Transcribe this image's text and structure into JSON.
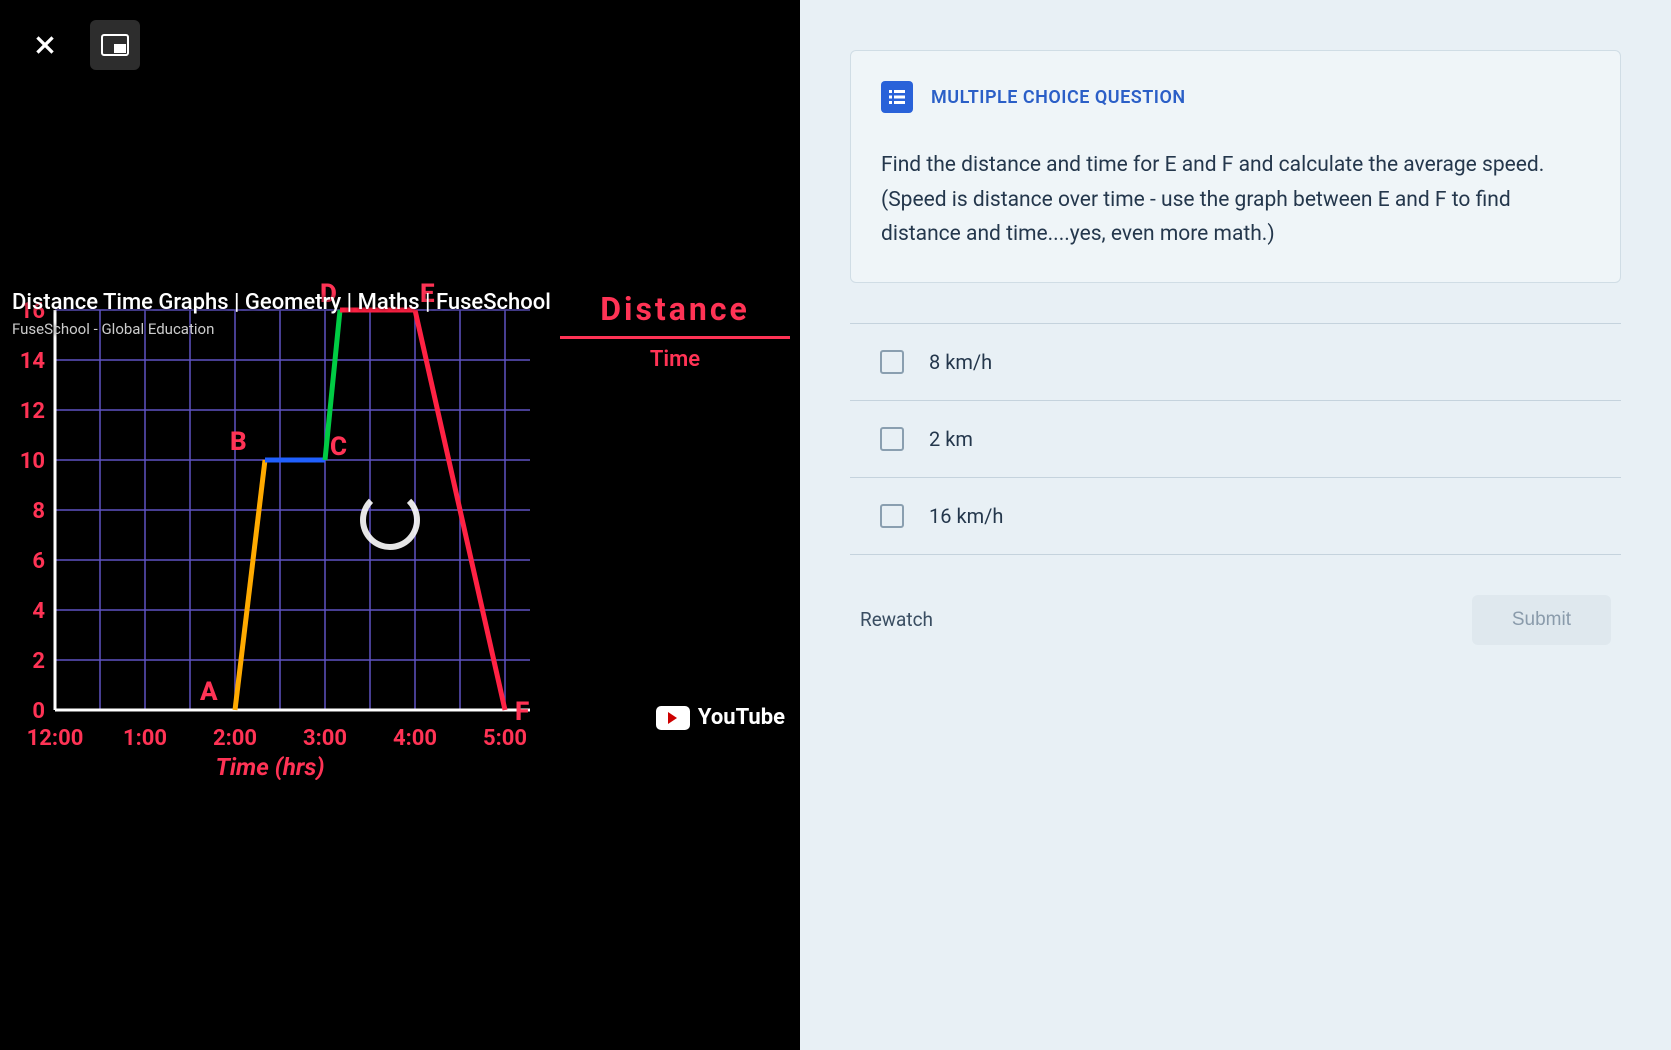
{
  "video": {
    "title": "Distance Time Graphs | Geometry | Maths | FuseSchool",
    "channel": "FuseSchool - Global Education",
    "brand": "YouTube"
  },
  "formula": {
    "numerator": "Distance",
    "denominator": "Time"
  },
  "chart_data": {
    "type": "line",
    "xlabel": "Time (hrs)",
    "ylabel": "",
    "x_ticks": [
      "12:00",
      "1:00",
      "2:00",
      "3:00",
      "4:00",
      "5:00"
    ],
    "y_ticks": [
      0,
      2,
      4,
      6,
      8,
      10,
      12,
      14,
      16
    ],
    "ylim": [
      0,
      16
    ],
    "points": {
      "A": {
        "x": "2:00",
        "y": 0
      },
      "B": {
        "x": "2:20",
        "y": 10
      },
      "C": {
        "x": "3:00",
        "y": 10
      },
      "D": {
        "x": "3:10",
        "y": 16
      },
      "E": {
        "x": "4:00",
        "y": 16
      },
      "F": {
        "x": "5:00",
        "y": 0
      }
    },
    "segments": [
      {
        "from": "A",
        "to": "B",
        "color": "#ffaa00"
      },
      {
        "from": "B",
        "to": "C",
        "color": "#2060ff"
      },
      {
        "from": "C",
        "to": "D",
        "color": "#00cc44"
      },
      {
        "from": "D",
        "to": "E",
        "color": "#ff2244"
      },
      {
        "from": "E",
        "to": "F",
        "color": "#ff2244"
      }
    ]
  },
  "question": {
    "type_label": "MULTIPLE CHOICE QUESTION",
    "prompt": "Find the distance and time for E and F and calculate the average speed. (Speed is distance over time - use the graph between E and F to find distance and time....yes, even more math.)",
    "options": [
      "8 km/h",
      "2 km",
      "16 km/h"
    ]
  },
  "actions": {
    "rewatch": "Rewatch",
    "submit": "Submit"
  }
}
